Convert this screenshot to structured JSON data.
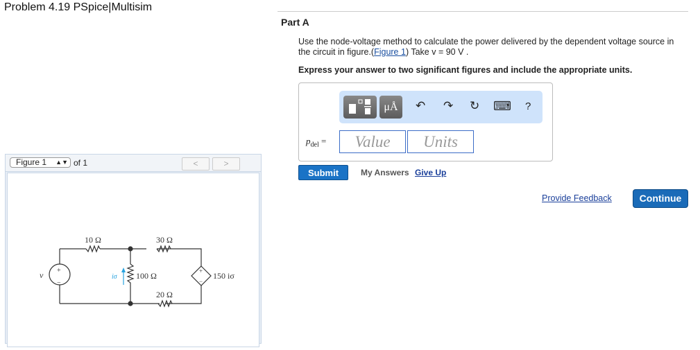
{
  "title": "Problem 4.19 PSpice|Multisim",
  "figure_nav": {
    "select": "Figure 1",
    "of": "of 1",
    "prev": "<",
    "next": ">"
  },
  "circuit": {
    "r1": "10 Ω",
    "r2": "30 Ω",
    "r3": "100 Ω",
    "r4": "20 Ω",
    "source": "v",
    "current": "iσ",
    "dep_source": "150 iσ",
    "plus": "+",
    "minus": "−"
  },
  "part": {
    "label": "Part A",
    "question_pre": "Use the node-voltage method to calculate the power delivered by the dependent voltage source in the circuit in figure.(",
    "figure_link": "Figure 1",
    "question_post": ") Take v = 90 V .",
    "instruction": "Express your answer to two significant figures and include the appropriate units."
  },
  "answer": {
    "label_var": "p",
    "label_sub": "del",
    "equals": "=",
    "value_placeholder": "Value",
    "units_placeholder": "Units",
    "toolbar": {
      "units_btn": "μÅ",
      "undo": "↶",
      "redo": "↷",
      "reset": "↻",
      "keyboard": "⌨",
      "help": "?"
    }
  },
  "actions": {
    "submit": "Submit",
    "my_answers": "My Answers",
    "give_up": "Give Up",
    "feedback": "Provide Feedback",
    "continue": "Continue"
  }
}
